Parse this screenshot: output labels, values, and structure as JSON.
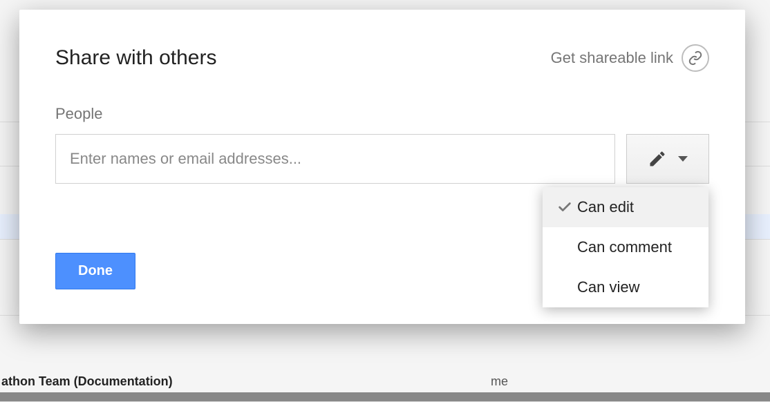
{
  "modal": {
    "title": "Share with others",
    "shareable_link_label": "Get shareable link",
    "people_label": "People",
    "input_placeholder": "Enter names or email addresses...",
    "done_label": "Done"
  },
  "permission_dropdown": {
    "selected_index": 0,
    "options": [
      {
        "label": "Can edit"
      },
      {
        "label": "Can comment"
      },
      {
        "label": "Can view"
      }
    ]
  },
  "background": {
    "row_text": "athon Team (Documentation)",
    "owner": "me"
  }
}
